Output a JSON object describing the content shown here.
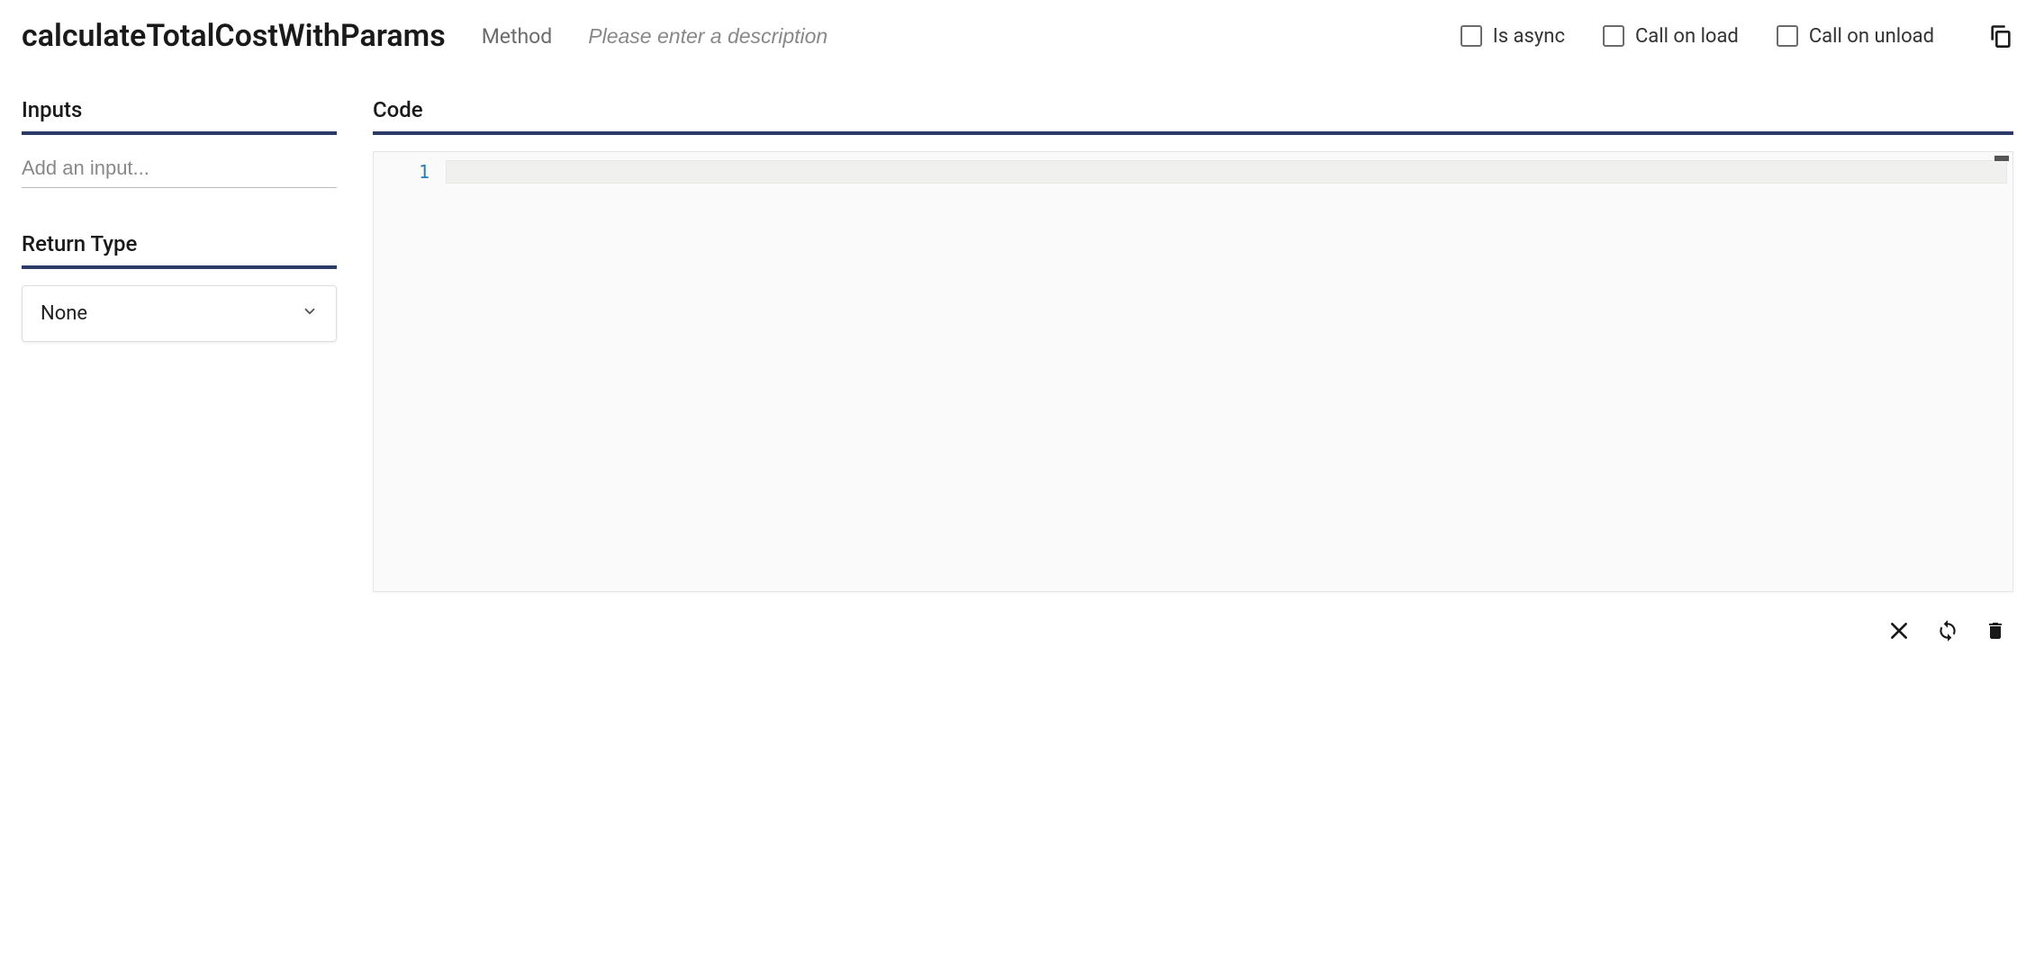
{
  "header": {
    "method_name": "calculateTotalCostWithParams",
    "type_label": "Method",
    "description_placeholder": "Please enter a description",
    "description_value": "",
    "checkbox_is_async": "Is async",
    "checkbox_call_on_load": "Call on load",
    "checkbox_call_on_unload": "Call on unload"
  },
  "sections": {
    "inputs_title": "Inputs",
    "add_input_placeholder": "Add an input...",
    "return_type_title": "Return Type",
    "return_type_value": "None",
    "code_title": "Code"
  },
  "code": {
    "line_number_1": "1",
    "content": ""
  }
}
